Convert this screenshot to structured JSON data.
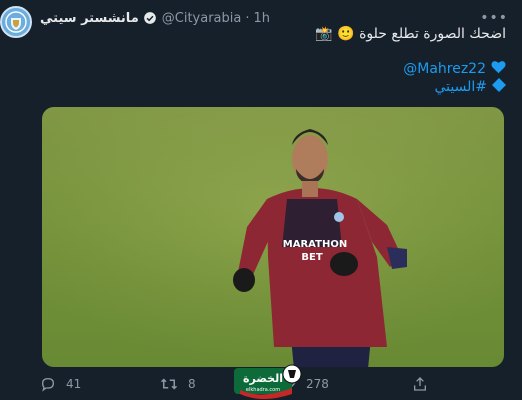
{
  "tweet": {
    "author_name": "مانشستر سيتي",
    "handle": "@Cityarabia",
    "separator": "·",
    "time": "1h",
    "text_line1": "اضحك الصورة تطلع حلوة",
    "emoji_smile": "🙂",
    "emoji_camera": "📸",
    "mention": "@Mahrez22",
    "hashtag": "#السيتي",
    "heart_color": "#1d9bf0"
  },
  "photo": {
    "shirt_sponsor_line1": "MARATHON",
    "shirt_sponsor_line2": "BET"
  },
  "actions": {
    "replies": "41",
    "retweets": "8",
    "likes": "278"
  },
  "watermark": {
    "text": "الخضرة",
    "subtext": "elkhadra.com"
  },
  "colors": {
    "background": "#15202b",
    "text": "#e7e9ea",
    "muted": "#8b98a5",
    "accent": "#1d9bf0"
  }
}
